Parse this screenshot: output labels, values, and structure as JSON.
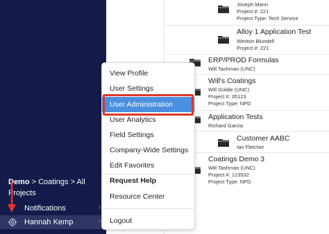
{
  "sidebar": {
    "breadcrumb_line1_bold": "Demo",
    "breadcrumb_line1_rest": " > Coatings > All",
    "breadcrumb_line2": "Projects",
    "notifications_label": "Notifications",
    "user_name": "Hannah Kemp",
    "chevron": "›",
    "bg_color": "#141a4a"
  },
  "menu": {
    "items": [
      {
        "label": "View Profile"
      },
      {
        "label": "User Settings"
      },
      {
        "label": "User Administration"
      },
      {
        "label": "User Analytics"
      },
      {
        "label": "Field Settings"
      },
      {
        "label": "Company-Wide Settings"
      },
      {
        "label": "Edit Favorites"
      },
      {
        "label": "Request Help"
      },
      {
        "label": "Resource Center"
      },
      {
        "label": "Logout"
      }
    ],
    "active_color": "#4a8fe0",
    "highlight_color": "#e0352b"
  },
  "projects": [
    {
      "owner": "Joseph Mann",
      "number": "Project #: 221",
      "type": "Project Type: Tech Service"
    },
    {
      "name": "Alloy 1 Application Test",
      "owner": "Weston Blundell",
      "number": "Project #: 221"
    },
    {
      "name": "ERP/PROD Formulas",
      "owner": "Will Tashman (UNC)"
    },
    {
      "name": "Will's Coatings",
      "owner": "Will Goldie (UNC)",
      "number": "Project #: 35123",
      "type": "Project Type: NPD"
    },
    {
      "name": "Application Tests",
      "owner": "Richard Garcia"
    },
    {
      "name": "Customer AABC",
      "owner": "Ian Fletcher"
    },
    {
      "name": "Coatings Demo 3",
      "owner": "Will Tashman (UNC)",
      "number": "Project #: 123532",
      "type": "Project Type: NPD"
    }
  ]
}
